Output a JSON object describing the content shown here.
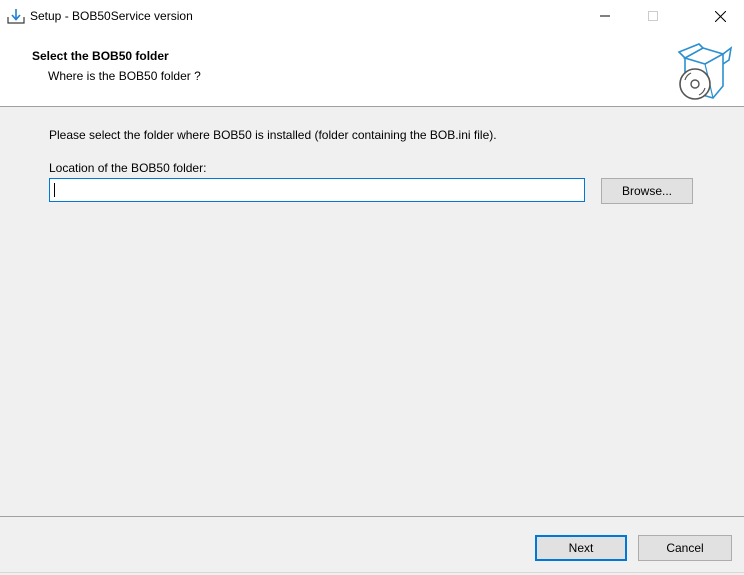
{
  "window": {
    "title": "Setup - BOB50Service version",
    "icon": "setup-install-icon"
  },
  "header": {
    "title": "Select the BOB50 folder",
    "subtitle": "Where is the BOB50 folder ?",
    "icon": "software-box-disc-icon"
  },
  "content": {
    "instruction": "Please select the folder where BOB50 is installed (folder containing the BOB.ini file).",
    "location_label": "Location of the BOB50 folder:",
    "path_value": "",
    "browse_label": "Browse..."
  },
  "footer": {
    "next_label": "Next",
    "cancel_label": "Cancel"
  },
  "colors": {
    "accent": "#0078d7",
    "panel_bg": "#f0f0f0",
    "button_bg": "#e1e1e1"
  }
}
